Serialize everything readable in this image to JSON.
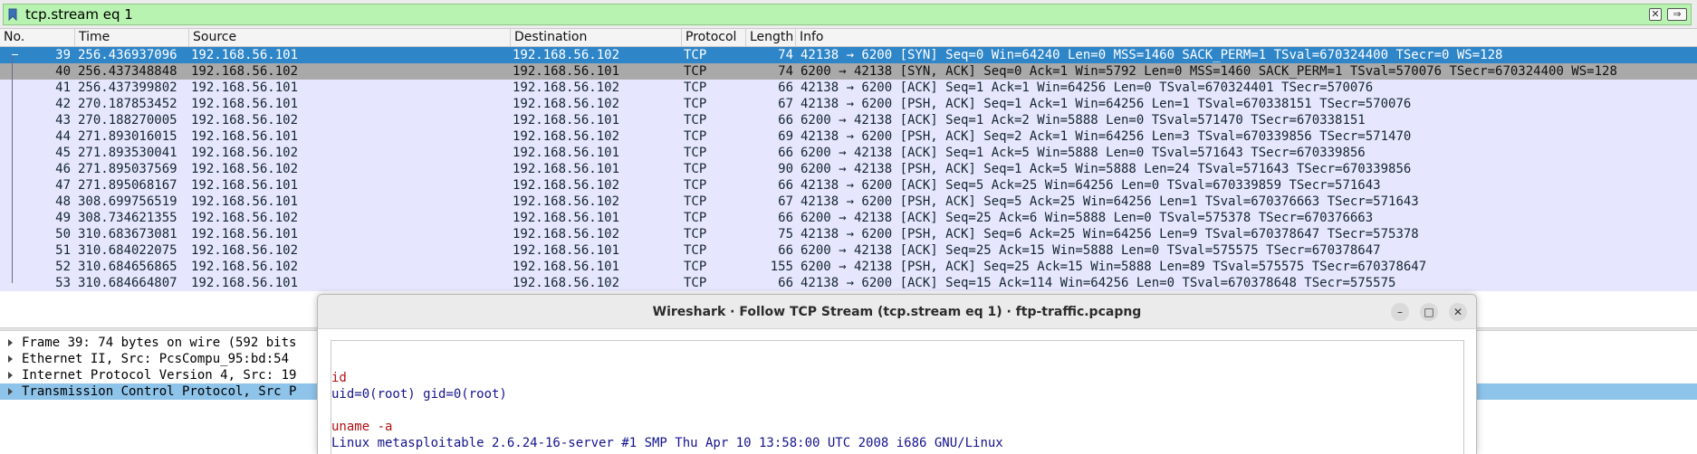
{
  "filter": {
    "value": "tcp.stream eq 1",
    "icons": [
      "bookmark-icon",
      "clear-icon",
      "apply-arrow-icon"
    ]
  },
  "packet_list": {
    "columns": [
      "No.",
      "Time",
      "Source",
      "Destination",
      "Protocol",
      "Length",
      "Info"
    ],
    "rows": [
      {
        "no": "39",
        "time": "256.436937096",
        "src": "192.168.56.101",
        "dst": "192.168.56.102",
        "proto": "TCP",
        "len": "74",
        "info": "42138 → 6200 [SYN] Seq=0 Win=64240 Len=0 MSS=1460 SACK_PERM=1 TSval=670324400 TSecr=0 WS=128"
      },
      {
        "no": "40",
        "time": "256.437348848",
        "src": "192.168.56.102",
        "dst": "192.168.56.101",
        "proto": "TCP",
        "len": "74",
        "info": "6200 → 42138 [SYN, ACK] Seq=0 Ack=1 Win=5792 Len=0 MSS=1460 SACK_PERM=1 TSval=570076 TSecr=670324400 WS=128"
      },
      {
        "no": "41",
        "time": "256.437399802",
        "src": "192.168.56.101",
        "dst": "192.168.56.102",
        "proto": "TCP",
        "len": "66",
        "info": "42138 → 6200 [ACK] Seq=1 Ack=1 Win=64256 Len=0 TSval=670324401 TSecr=570076"
      },
      {
        "no": "42",
        "time": "270.187853452",
        "src": "192.168.56.101",
        "dst": "192.168.56.102",
        "proto": "TCP",
        "len": "67",
        "info": "42138 → 6200 [PSH, ACK] Seq=1 Ack=1 Win=64256 Len=1 TSval=670338151 TSecr=570076"
      },
      {
        "no": "43",
        "time": "270.188270005",
        "src": "192.168.56.102",
        "dst": "192.168.56.101",
        "proto": "TCP",
        "len": "66",
        "info": "6200 → 42138 [ACK] Seq=1 Ack=2 Win=5888 Len=0 TSval=571470 TSecr=670338151"
      },
      {
        "no": "44",
        "time": "271.893016015",
        "src": "192.168.56.101",
        "dst": "192.168.56.102",
        "proto": "TCP",
        "len": "69",
        "info": "42138 → 6200 [PSH, ACK] Seq=2 Ack=1 Win=64256 Len=3 TSval=670339856 TSecr=571470"
      },
      {
        "no": "45",
        "time": "271.893530041",
        "src": "192.168.56.102",
        "dst": "192.168.56.101",
        "proto": "TCP",
        "len": "66",
        "info": "6200 → 42138 [ACK] Seq=1 Ack=5 Win=5888 Len=0 TSval=571643 TSecr=670339856"
      },
      {
        "no": "46",
        "time": "271.895037569",
        "src": "192.168.56.102",
        "dst": "192.168.56.101",
        "proto": "TCP",
        "len": "90",
        "info": "6200 → 42138 [PSH, ACK] Seq=1 Ack=5 Win=5888 Len=24 TSval=571643 TSecr=670339856"
      },
      {
        "no": "47",
        "time": "271.895068167",
        "src": "192.168.56.101",
        "dst": "192.168.56.102",
        "proto": "TCP",
        "len": "66",
        "info": "42138 → 6200 [ACK] Seq=5 Ack=25 Win=64256 Len=0 TSval=670339859 TSecr=571643"
      },
      {
        "no": "48",
        "time": "308.699756519",
        "src": "192.168.56.101",
        "dst": "192.168.56.102",
        "proto": "TCP",
        "len": "67",
        "info": "42138 → 6200 [PSH, ACK] Seq=5 Ack=25 Win=64256 Len=1 TSval=670376663 TSecr=571643"
      },
      {
        "no": "49",
        "time": "308.734621355",
        "src": "192.168.56.102",
        "dst": "192.168.56.101",
        "proto": "TCP",
        "len": "66",
        "info": "6200 → 42138 [ACK] Seq=25 Ack=6 Win=5888 Len=0 TSval=575378 TSecr=670376663"
      },
      {
        "no": "50",
        "time": "310.683673081",
        "src": "192.168.56.101",
        "dst": "192.168.56.102",
        "proto": "TCP",
        "len": "75",
        "info": "42138 → 6200 [PSH, ACK] Seq=6 Ack=25 Win=64256 Len=9 TSval=670378647 TSecr=575378"
      },
      {
        "no": "51",
        "time": "310.684022075",
        "src": "192.168.56.102",
        "dst": "192.168.56.101",
        "proto": "TCP",
        "len": "66",
        "info": "6200 → 42138 [ACK] Seq=25 Ack=15 Win=5888 Len=0 TSval=575575 TSecr=670378647"
      },
      {
        "no": "52",
        "time": "310.684656865",
        "src": "192.168.56.102",
        "dst": "192.168.56.101",
        "proto": "TCP",
        "len": "155",
        "info": "6200 → 42138 [PSH, ACK] Seq=25 Ack=15 Win=5888 Len=89 TSval=575575 TSecr=670378647"
      },
      {
        "no": "53",
        "time": "310.684664807",
        "src": "192.168.56.101",
        "dst": "192.168.56.102",
        "proto": "TCP",
        "len": "66",
        "info": "42138 → 6200 [ACK] Seq=15 Ack=114 Win=64256 Len=0 TSval=670378648 TSecr=575575"
      }
    ]
  },
  "details": {
    "rows": [
      "Frame 39: 74 bytes on wire (592 bits",
      "Ethernet II, Src: PcsCompu_95:bd:54",
      "Internet Protocol Version 4, Src: 19",
      "Transmission Control Protocol, Src P"
    ]
  },
  "dialog": {
    "title": "Wireshark · Follow TCP Stream (tcp.stream eq 1) · ftp-traffic.pcapng",
    "buttons": [
      "minimize-icon",
      "maximize-icon",
      "close-icon"
    ],
    "stream": {
      "line1": "id",
      "line2": "uid=0(root) gid=0(root)",
      "line3": "uname -a",
      "line4": "Linux metasploitable 2.6.24-16-server #1 SMP Thu Apr 10 13:58:00 UTC 2008 i686 GNU/Linux"
    }
  },
  "colors": {
    "filter_valid": "#b8f3b1",
    "row_bg": "#e7e6ff",
    "selected": "#2e85c8",
    "related": "#a9a9a9",
    "client_text": "#b01212",
    "server_text": "#14148c"
  }
}
